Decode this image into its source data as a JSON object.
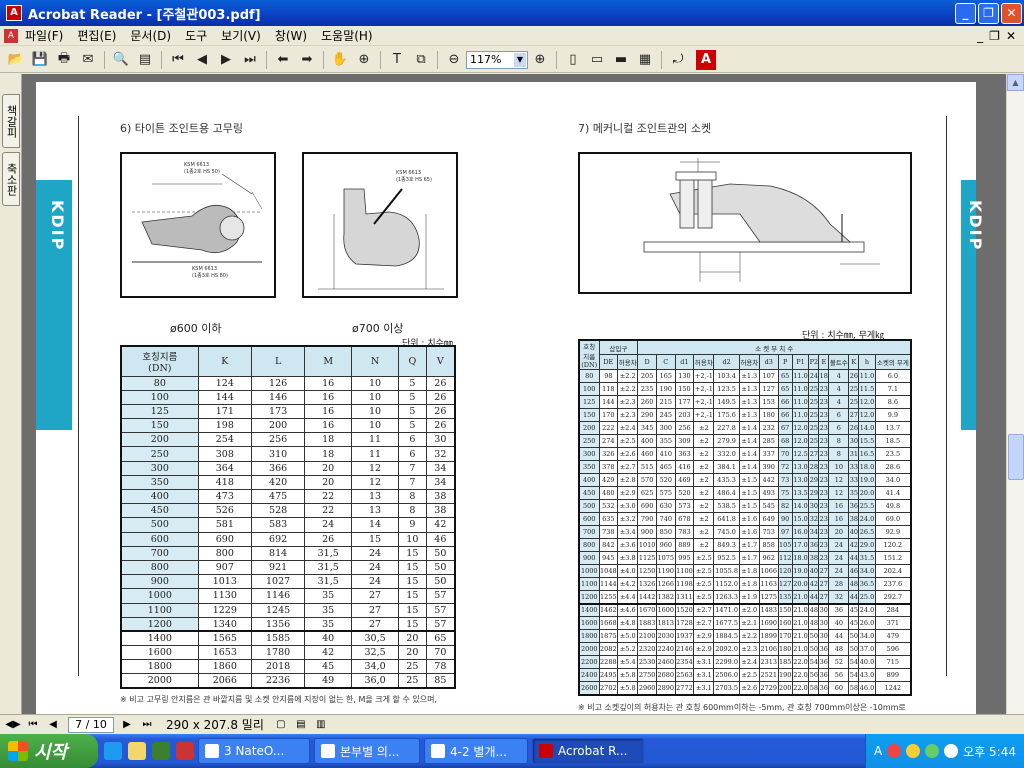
{
  "window": {
    "app_icon": "acrobat-icon",
    "title": "Acrobat Reader - [주철관003.pdf]",
    "min": "_",
    "restore": "❐",
    "close": "✕"
  },
  "menu": [
    "파일(F)",
    "편집(E)",
    "문서(D)",
    "도구",
    "보기(V)",
    "창(W)",
    "도움말(H)"
  ],
  "mdi": [
    "_",
    "❐",
    "✕"
  ],
  "toolbar": {
    "zoom": "117%"
  },
  "left_tabs": [
    "책갈피",
    "축소판"
  ],
  "status": {
    "page": "7 / 10",
    "size": "290 x 207.8 밀리"
  },
  "taskbar": {
    "start": "시작",
    "tasks": [
      "3 NateO...",
      "본부별 의...",
      "4-2 별개...",
      "Acrobat R..."
    ],
    "time": "오후 5:44",
    "ime": "A"
  },
  "doc": {
    "side_label": "KDIP",
    "left": {
      "section": "6) 타이튼 조인트용 고무링",
      "fig1_cap": "ø600 이하",
      "fig2_cap": "ø700 이상",
      "fig1_std": "KSM 6613\n(1종2호 HS 50)",
      "fig1_std2": "KSM 6613\n(1종3호 HS 80)",
      "fig2_std": "KSM 6613\n(1종3호 HS 65)",
      "unit": "단위 : 치수㎜",
      "headers": [
        "호칭지름\n(DN)",
        "K",
        "L",
        "M",
        "N",
        "Q",
        "V"
      ],
      "rows": [
        [
          "80",
          "124",
          "126",
          "16",
          "10",
          "5",
          "26"
        ],
        [
          "100",
          "144",
          "146",
          "16",
          "10",
          "5",
          "26"
        ],
        [
          "125",
          "171",
          "173",
          "16",
          "10",
          "5",
          "26"
        ],
        [
          "150",
          "198",
          "200",
          "16",
          "10",
          "5",
          "26"
        ],
        [
          "200",
          "254",
          "256",
          "18",
          "11",
          "6",
          "30"
        ],
        [
          "250",
          "308",
          "310",
          "18",
          "11",
          "6",
          "32"
        ],
        [
          "300",
          "364",
          "366",
          "20",
          "12",
          "7",
          "34"
        ],
        [
          "350",
          "418",
          "420",
          "20",
          "12",
          "7",
          "34"
        ],
        [
          "400",
          "473",
          "475",
          "22",
          "13",
          "8",
          "38"
        ],
        [
          "450",
          "526",
          "528",
          "22",
          "13",
          "8",
          "38"
        ],
        [
          "500",
          "581",
          "583",
          "24",
          "14",
          "9",
          "42"
        ],
        [
          "600",
          "690",
          "692",
          "26",
          "15",
          "10",
          "46"
        ],
        [
          "700",
          "800",
          "814",
          "31,5",
          "24",
          "15",
          "50"
        ],
        [
          "800",
          "907",
          "921",
          "31,5",
          "24",
          "15",
          "50"
        ],
        [
          "900",
          "1013",
          "1027",
          "31,5",
          "24",
          "15",
          "50"
        ],
        [
          "1000",
          "1130",
          "1146",
          "35",
          "27",
          "15",
          "57"
        ],
        [
          "1100",
          "1229",
          "1245",
          "35",
          "27",
          "15",
          "57"
        ],
        [
          "1200",
          "1340",
          "1356",
          "35",
          "27",
          "15",
          "57"
        ],
        [
          "1400",
          "1565",
          "1585",
          "40",
          "30,5",
          "20",
          "65"
        ],
        [
          "1600",
          "1653",
          "1780",
          "42",
          "32,5",
          "20",
          "70"
        ],
        [
          "1800",
          "1860",
          "2018",
          "45",
          "34,0",
          "25",
          "78"
        ],
        [
          "2000",
          "2066",
          "2236",
          "49",
          "36,0",
          "25",
          "85"
        ]
      ],
      "note": "※ 비고  고무링 안지름은 관 바깥지름 및 소켓 안지름에 지장이 없는 한, M을 크게 할 수 있으며,"
    },
    "right": {
      "section": "7) 메커니컬 조인트관의 소켓",
      "unit": "단위 : 치수㎜, 무게㎏",
      "h1": [
        "호칭\n지름\n(DN)",
        "삽입구",
        "소   켓   부   치   수"
      ],
      "h2": [
        "DE",
        "허용차",
        "D",
        "C",
        "d1",
        "허용차",
        "d2",
        "허용차",
        "d3",
        "P",
        "P1",
        "P2",
        "E",
        "볼트수",
        "K",
        "h",
        "소켓의 무게"
      ],
      "rows": [
        [
          "80",
          "98",
          "±2.2",
          "205",
          "165",
          "130",
          "+2,-1",
          "103.4",
          "±1.3",
          "107",
          "65",
          "11.0",
          "24",
          "18",
          "4",
          "26",
          "11.0",
          "6.0"
        ],
        [
          "100",
          "118",
          "±2.2",
          "235",
          "190",
          "150",
          "+2,-1",
          "123.5",
          "±1.3",
          "127",
          "65",
          "11.0",
          "25",
          "23",
          "4",
          "25",
          "11.5",
          "7.1"
        ],
        [
          "125",
          "144",
          "±2.3",
          "260",
          "215",
          "177",
          "+2,-1",
          "149.5",
          "±1.3",
          "153",
          "66",
          "11.0",
          "25",
          "23",
          "4",
          "25",
          "12.0",
          "8.6"
        ],
        [
          "150",
          "170",
          "±2.3",
          "290",
          "245",
          "203",
          "+2,-1",
          "175.6",
          "±1.3",
          "180",
          "66",
          "11.0",
          "25",
          "23",
          "6",
          "27",
          "12.0",
          "9.9"
        ],
        [
          "200",
          "222",
          "±2.4",
          "345",
          "300",
          "256",
          "±2",
          "227.8",
          "±1.4",
          "232",
          "67",
          "12.0",
          "25",
          "23",
          "6",
          "26",
          "14.0",
          "13.7"
        ],
        [
          "250",
          "274",
          "±2.5",
          "400",
          "355",
          "309",
          "±2",
          "279.9",
          "±1.4",
          "285",
          "68",
          "12.0",
          "25",
          "23",
          "8",
          "30",
          "15.5",
          "18.5"
        ],
        [
          "300",
          "326",
          "±2.6",
          "460",
          "410",
          "363",
          "±2",
          "332.0",
          "±1.4",
          "337",
          "70",
          "12.5",
          "27",
          "23",
          "8",
          "31",
          "16.5",
          "23.5"
        ],
        [
          "350",
          "378",
          "±2.7",
          "515",
          "465",
          "416",
          "±2",
          "384.1",
          "±1.4",
          "390",
          "72",
          "13.0",
          "28",
          "23",
          "10",
          "33",
          "18.0",
          "28.6"
        ],
        [
          "400",
          "429",
          "±2.8",
          "570",
          "520",
          "469",
          "±2",
          "435.3",
          "±1.5",
          "442",
          "73",
          "13.0",
          "29",
          "23",
          "12",
          "33",
          "19.0",
          "34.0"
        ],
        [
          "450",
          "480",
          "±2.9",
          "625",
          "575",
          "520",
          "±2",
          "486.4",
          "±1.5",
          "493",
          "75",
          "13.5",
          "29",
          "23",
          "12",
          "35",
          "20.0",
          "41.4"
        ],
        [
          "500",
          "532",
          "±3.0",
          "690",
          "630",
          "573",
          "±2",
          "538.5",
          "±1.5",
          "545",
          "82",
          "14.0",
          "30",
          "23",
          "16",
          "36",
          "25.5",
          "49.8"
        ],
        [
          "600",
          "635",
          "±3.2",
          "790",
          "740",
          "678",
          "±2",
          "641.8",
          "±1.6",
          "649",
          "90",
          "15.0",
          "32",
          "23",
          "16",
          "38",
          "24.0",
          "69.0"
        ],
        [
          "700",
          "738",
          "±3.4",
          "900",
          "850",
          "783",
          "±2",
          "745.0",
          "±1.6",
          "753",
          "97",
          "16.0",
          "34",
          "23",
          "20",
          "40",
          "26.5",
          "92.9"
        ],
        [
          "800",
          "842",
          "±3.6",
          "1010",
          "960",
          "889",
          "±2",
          "849.3",
          "±1.7",
          "858",
          "105",
          "17.0",
          "36",
          "23",
          "24",
          "42",
          "29.0",
          "120.2"
        ],
        [
          "900",
          "945",
          "±3.8",
          "1125",
          "1075",
          "995",
          "±2.5",
          "952.5",
          "±1.7",
          "962",
          "112",
          "18.0",
          "38",
          "23",
          "24",
          "44",
          "31.5",
          "151.2"
        ],
        [
          "1000",
          "1048",
          "±4.0",
          "1250",
          "1190",
          "1100",
          "±2.5",
          "1055.8",
          "±1.8",
          "1066",
          "120",
          "19.0",
          "40",
          "27",
          "24",
          "46",
          "34.0",
          "202.4"
        ],
        [
          "1100",
          "1144",
          "±4.2",
          "1326",
          "1266",
          "1198",
          "±2.5",
          "1152.0",
          "±1.8",
          "1163",
          "127",
          "20.0",
          "42",
          "27",
          "28",
          "48",
          "36.5",
          "237.6"
        ],
        [
          "1200",
          "1255",
          "±4.4",
          "1442",
          "1382",
          "1311",
          "±2.5",
          "1263.3",
          "±1.9",
          "1275",
          "135",
          "21.0",
          "44",
          "27",
          "32",
          "44",
          "25.0",
          "292.7"
        ],
        [
          "1400",
          "1462",
          "±4.6",
          "1670",
          "1600",
          "1520",
          "±2.7",
          "1471.0",
          "±2.0",
          "1483",
          "150",
          "21.0",
          "48",
          "30",
          "36",
          "45",
          "24.0",
          "284"
        ],
        [
          "1600",
          "1668",
          "±4.8",
          "1883",
          "1813",
          "1728",
          "±2.7",
          "1677.5",
          "±2.1",
          "1690",
          "160",
          "21.0",
          "48",
          "30",
          "40",
          "45",
          "26.0",
          "371"
        ],
        [
          "1800",
          "1875",
          "±5.0",
          "2100",
          "2030",
          "1937",
          "±2.9",
          "1884.5",
          "±2.2",
          "1899",
          "170",
          "21.0",
          "50",
          "30",
          "44",
          "50",
          "34.0",
          "479"
        ],
        [
          "2000",
          "2082",
          "±5.2",
          "2320",
          "2240",
          "2146",
          "±2.9",
          "2092.0",
          "±2.3",
          "2106",
          "180",
          "21.0",
          "50",
          "36",
          "48",
          "50",
          "37.0",
          "596"
        ],
        [
          "2200",
          "2288",
          "±5.4",
          "2530",
          "2460",
          "2354",
          "±3.1",
          "2299.0",
          "±2.4",
          "2313",
          "185",
          "22.0",
          "54",
          "36",
          "52",
          "54",
          "40.0",
          "715"
        ],
        [
          "2400",
          "2495",
          "±5.8",
          "2750",
          "2680",
          "2563",
          "±3.1",
          "2506.0",
          "±2.5",
          "2521",
          "190",
          "22.0",
          "56",
          "36",
          "56",
          "54",
          "43.0",
          "899"
        ],
        [
          "2600",
          "2702",
          "±5.8",
          "2960",
          "2890",
          "2772",
          "±3.1",
          "2703.5",
          "±2.6",
          "2729",
          "200",
          "22.0",
          "58",
          "36",
          "60",
          "58",
          "46.0",
          "1242"
        ]
      ],
      "note": "※ 비고   소켓깊이의 허용차는 관 호칭 600mm이하는 -5mm, 관 호칭 700mm이상은 -10mm로"
    }
  }
}
